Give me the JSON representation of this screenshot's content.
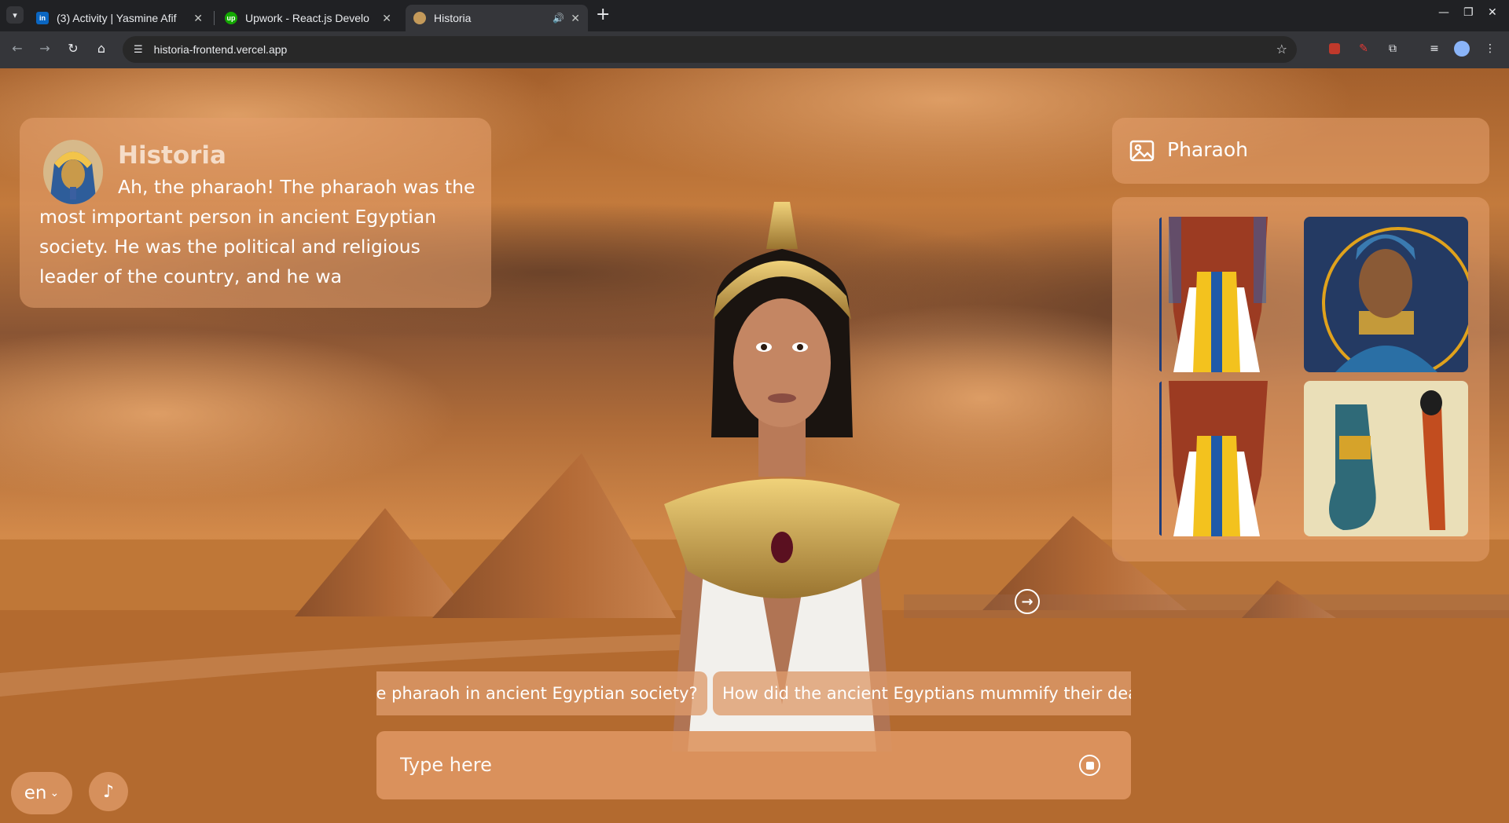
{
  "browser": {
    "tabs": [
      {
        "title": "(3) Activity | Yasmine Afif",
        "favicon": "linkedin-icon",
        "color": "#0a66c2",
        "active": false
      },
      {
        "title": "Upwork - React.js Develo",
        "favicon": "upwork-icon",
        "color": "#14a800",
        "active": false
      },
      {
        "title": "Historia",
        "favicon": "historia-icon",
        "color": "#c49a5a",
        "active": true
      }
    ],
    "url": "historia-frontend.vercel.app"
  },
  "chat": {
    "title": "Historia",
    "message": "Ah, the pharaoh! The pharaoh was the most important person in ancient Egyptian society. He was the political and religious leader of the country, and he wa"
  },
  "images_panel": {
    "label": "Pharaoh",
    "icon": "image-icon"
  },
  "suggestions": [
    "What was the role of the pharaoh in ancient Egyptian society?",
    "How did the ancient Egyptians mummify their dead?"
  ],
  "input": {
    "placeholder": "Type here"
  },
  "language": {
    "value": "en",
    "icon": "chevron-down-icon"
  },
  "music": {
    "icon": "music-note-icon"
  }
}
